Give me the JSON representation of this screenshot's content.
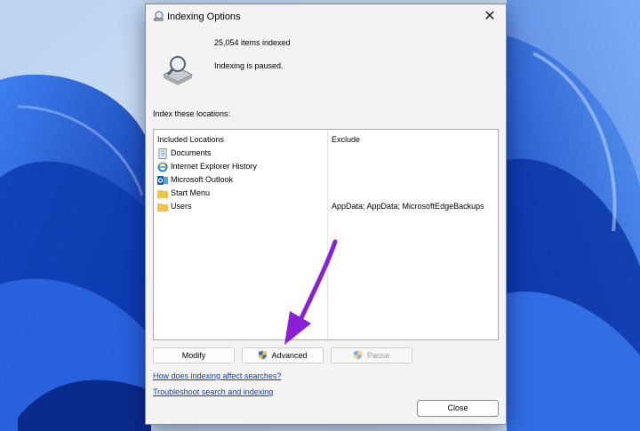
{
  "dialog": {
    "title": "Indexing Options",
    "close_glyph": "✕",
    "items_indexed": "25,054 items indexed",
    "status": "Indexing is paused.",
    "index_locations_label": "Index these locations:"
  },
  "list": {
    "header_included": "Included Locations",
    "header_exclude": "Exclude",
    "rows": [
      {
        "label": "Documents",
        "icon": "documents-icon",
        "exclude": ""
      },
      {
        "label": "Internet Explorer History",
        "icon": "internet-explorer-icon",
        "exclude": ""
      },
      {
        "label": "Microsoft Outlook",
        "icon": "outlook-icon",
        "exclude": ""
      },
      {
        "label": "Start Menu",
        "icon": "folder-icon",
        "exclude": ""
      },
      {
        "label": "Users",
        "icon": "folder-icon",
        "exclude": "AppData; AppData; MicrosoftEdgeBackups"
      }
    ]
  },
  "buttons": {
    "modify": "Modify",
    "advanced": "Advanced",
    "pause": "Pause",
    "close": "Close"
  },
  "links": {
    "how_affects": "How does indexing affect searches?",
    "troubleshoot": "Troubleshoot search and indexing"
  },
  "colors": {
    "annotation_arrow": "#8a1fd6",
    "link": "#0645b5",
    "wallpaper_accent": "#1a5bd6"
  }
}
